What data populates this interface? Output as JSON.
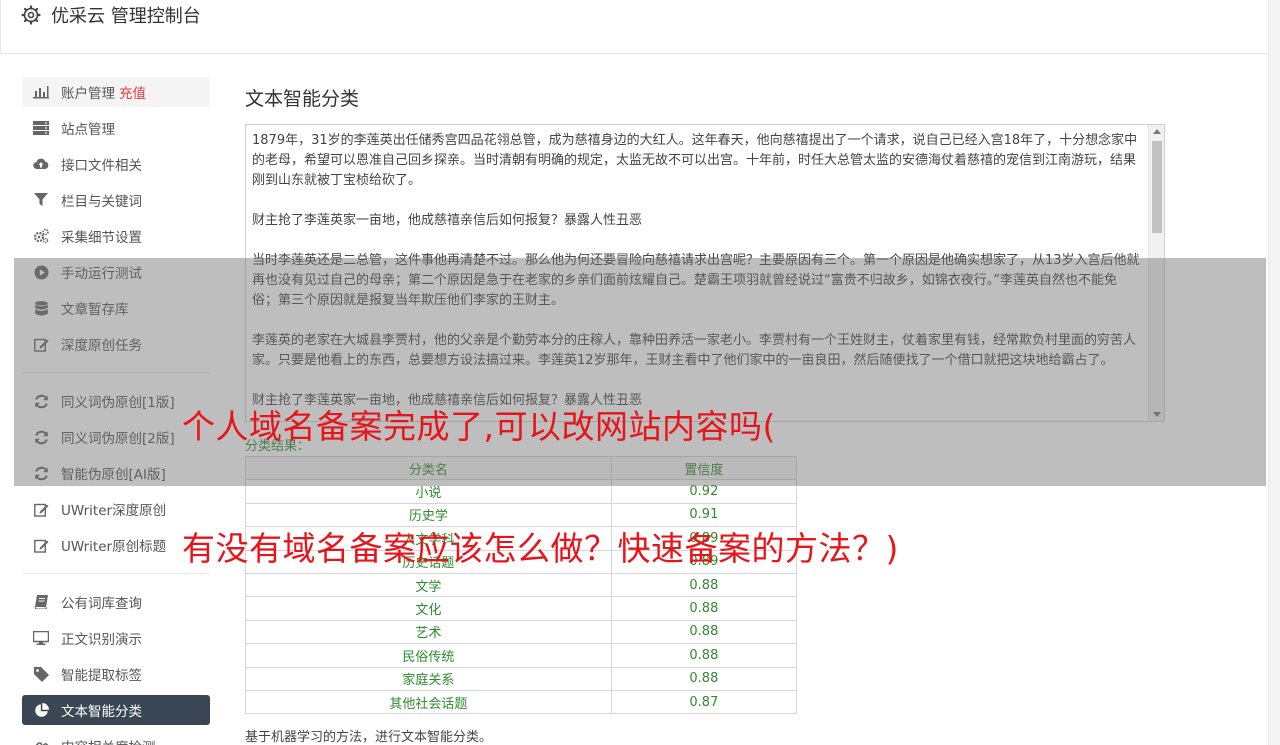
{
  "header": {
    "title": "优采云 管理控制台"
  },
  "sidebar": {
    "items": [
      {
        "label": "账户管理",
        "extra": "充值",
        "icon": "bar-chart-icon"
      },
      {
        "label": "站点管理",
        "icon": "server-icon"
      },
      {
        "label": "接口文件相关",
        "icon": "cloud-upload-icon"
      },
      {
        "label": "栏目与关键词",
        "icon": "filter-icon"
      },
      {
        "label": "采集细节设置",
        "icon": "gears-icon"
      },
      {
        "label": "手动运行测试",
        "icon": "play-circle-icon"
      },
      {
        "label": "文章暂存库",
        "icon": "database-icon"
      },
      {
        "label": "深度原创任务",
        "icon": "edit-icon"
      },
      {
        "label": "同义词伪原创[1版]",
        "icon": "refresh-icon"
      },
      {
        "label": "同义词伪原创[2版]",
        "icon": "refresh-icon"
      },
      {
        "label": "智能伪原创[AI版]",
        "icon": "refresh-icon"
      },
      {
        "label": "UWriter深度原创",
        "icon": "edit-icon"
      },
      {
        "label": "UWriter原创标题",
        "icon": "edit-icon"
      },
      {
        "label": "公有词库查询",
        "icon": "book-icon"
      },
      {
        "label": "正文识别演示",
        "icon": "monitor-icon"
      },
      {
        "label": "智能提取标签",
        "icon": "tag-icon"
      },
      {
        "label": "文本智能分类",
        "icon": "pie-chart-icon"
      },
      {
        "label": "内容相关度检测",
        "icon": "link-icon"
      }
    ]
  },
  "main": {
    "title": "文本智能分类",
    "text_paragraphs": [
      "1879年，31岁的李莲英出任储秀宫四品花翎总管，成为慈禧身边的大红人。这年春天，他向慈禧提出了一个请求，说自己已经入宫18年了，十分想念家中的老母，希望可以恩准自己回乡探亲。当时清朝有明确的规定，太监无故不可以出宫。十年前，时任大总管太监的安德海仗着慈禧的宠信到江南游玩，结果刚到山东就被丁宝桢给砍了。",
      "财主抢了李莲英家一亩地，他成慈禧亲信后如何报复？暴露人性丑恶",
      "当时李莲英还是二总管，这件事他再清楚不过。那么他为何还要冒险向慈禧请求出宫呢？主要原因有三个。第一个原因是他确实想家了，从13岁入宫后他就再也没有见过自己的母亲；第二个原因是急于在老家的乡亲们面前炫耀自己。楚霸王项羽就曾经说过“富贵不归故乡，如锦衣夜行。”李莲英自然也不能免俗；第三个原因就是报复当年欺压他们李家的王财主。",
      "李莲英的老家在大城县李贾村，他的父亲是个勤劳本分的庄稼人，靠种田养活一家老小。李贾村有一个王姓财主，仗着家里有钱，经常欺负村里面的穷苦人家。只要是他看上的东西，总要想方设法搞过来。李莲英12岁那年，王财主看中了他们家中的一亩良田，然后随便找了一个借口就把这块地给霸占了。",
      "财主抢了李莲英家一亩地，他成慈禧亲信后如何报复？暴露人性丑恶"
    ],
    "result_label": "分类结果：",
    "table": {
      "headers": [
        "分类名",
        "置信度"
      ],
      "rows": [
        [
          "小说",
          "0.92"
        ],
        [
          "历史学",
          "0.91"
        ],
        [
          "人文学科",
          "0.89"
        ],
        [
          "历史话题",
          "0.89"
        ],
        [
          "文学",
          "0.88"
        ],
        [
          "文化",
          "0.88"
        ],
        [
          "艺术",
          "0.88"
        ],
        [
          "民俗传统",
          "0.88"
        ],
        [
          "家庭关系",
          "0.88"
        ],
        [
          "其他社会话题",
          "0.87"
        ]
      ]
    },
    "footnote": "基于机器学习的方法，进行文本智能分类。"
  },
  "overlay": {
    "line1": "个人域名备案完成了,可以改网站内容吗(",
    "line2": "有没有域名备案应该怎么做？快速备案的方法？)"
  },
  "colors": {
    "accent_red": "#e4393c",
    "headline_red": "#e8141a",
    "result_green": "#2e8b2e",
    "active_menu_bg": "#3a4654"
  }
}
